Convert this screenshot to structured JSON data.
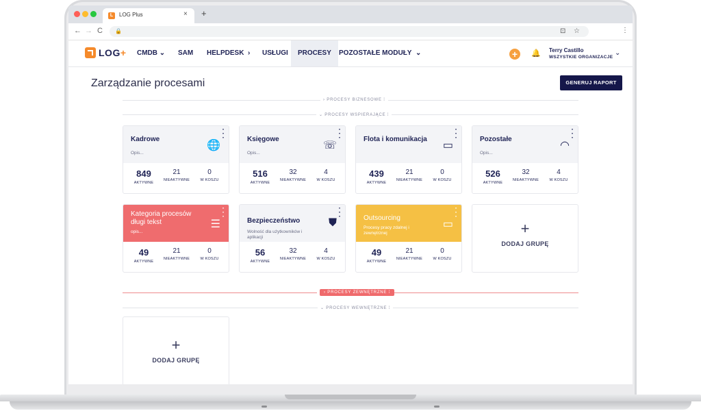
{
  "browser": {
    "tab_title": "LOG Plus",
    "tab_favicon_letter": "L",
    "close_glyph": "×",
    "newtab_glyph": "+",
    "back_glyph": "←",
    "forward_glyph": "→",
    "reload_glyph": "C",
    "lock_glyph": "🔒",
    "translate_glyph": "⊡",
    "star_glyph": "☆",
    "menu_glyph": "⋮"
  },
  "header": {
    "logo_main": "LOG",
    "logo_plus": "+",
    "nav": [
      {
        "label": "CMDB",
        "chevron": "⌄"
      },
      {
        "label": "SAM"
      },
      {
        "label": "HELPDESK",
        "chevron": "›"
      },
      {
        "label": "USŁUGI"
      },
      {
        "label": "PROCESY",
        "active": true
      },
      {
        "label": "POZOSTAŁE MODUŁY",
        "chevron": "⌄"
      }
    ],
    "add_glyph": "+",
    "bell_glyph": "🔔",
    "user_name": "Terry Castillo",
    "user_org": "WSZYSTKIE ORGANIZACJE",
    "user_chevron": "⌄"
  },
  "page": {
    "title": "Zarządzanie procesami",
    "report_button": "GENERUJ RAPORT"
  },
  "sections": {
    "business": "› PROCESY BIZNESOWE ⁞",
    "supporting": "⌄ PROCESY WSPIERAJĄCE ⁞",
    "external": "› PROCESY ZEWNĘTRZNE ⁞",
    "internal": "⌄ PROCESY WEWNĘTRZNE ⁞"
  },
  "stat_labels": {
    "active": "AKTYWNE",
    "inactive": "NIEAKTYWNE",
    "trash": "W KOSZU"
  },
  "cards": [
    {
      "name": "Kadrowe",
      "desc": "Opis...",
      "icon": "globe-icon",
      "glyph": "🌐",
      "active": "849",
      "inactive": "21",
      "trash": "0"
    },
    {
      "name": "Księgowe",
      "desc": "Opis...",
      "icon": "phone-icon",
      "glyph": "☏",
      "active": "516",
      "inactive": "32",
      "trash": "4"
    },
    {
      "name": "Flota i komunikacja",
      "desc": "",
      "icon": "chat-icon",
      "glyph": "▭",
      "active": "439",
      "inactive": "21",
      "trash": "0"
    },
    {
      "name": "Pozostałe",
      "desc": "Opis...",
      "icon": "wifi-icon",
      "glyph": "◠",
      "active": "526",
      "inactive": "32",
      "trash": "4"
    },
    {
      "name": "Kategoria procesów długi tekst",
      "desc": "opis...",
      "icon": "list-icon",
      "glyph": "☰",
      "active": "49",
      "inactive": "21",
      "trash": "0",
      "color": "#ef6c6e"
    },
    {
      "name": "Bezpieczeństwo",
      "desc": "Wolność dla użytkowników i aplikacji",
      "icon": "shield-icon",
      "glyph": "⛊",
      "active": "56",
      "inactive": "32",
      "trash": "4"
    },
    {
      "name": "Outsourcing",
      "desc": "Procesy pracy zdalnej i zewnętrznej",
      "icon": "monitor-icon",
      "glyph": "▭",
      "active": "49",
      "inactive": "21",
      "trash": "0",
      "color": "#f5c044"
    }
  ],
  "add_group": {
    "plus": "+",
    "label": "DODAJ GRUPĘ"
  },
  "colors": {
    "brand": "#f58a2b",
    "navy": "#1f2355",
    "red": "#ef6c6e",
    "yellow": "#f5c044"
  }
}
